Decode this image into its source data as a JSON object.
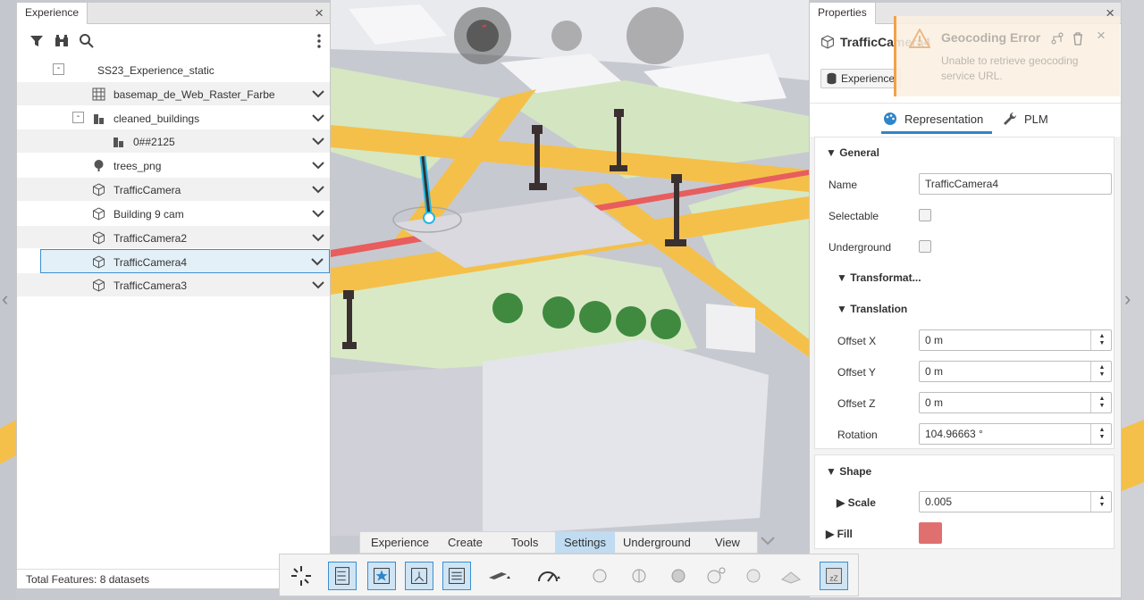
{
  "left_panel": {
    "tab": "Experience",
    "tree": [
      {
        "label": "SS23_Experience_static",
        "icon": "collapse-icon"
      },
      {
        "label": "basemap_de_Web_Raster_Farbe",
        "icon": "raster-icon"
      },
      {
        "label": "cleaned_buildings",
        "icon": "buildings-icon"
      },
      {
        "label": "0##2125",
        "icon": "buildings-icon"
      },
      {
        "label": "trees_png",
        "icon": "tree-icon"
      },
      {
        "label": "TrafficCamera",
        "icon": "cube-icon"
      },
      {
        "label": "Building 9 cam",
        "icon": "cube-icon"
      },
      {
        "label": "TrafficCamera2",
        "icon": "cube-icon"
      },
      {
        "label": "TrafficCamera4",
        "icon": "cube-icon"
      },
      {
        "label": "TrafficCamera3",
        "icon": "cube-icon"
      }
    ],
    "footer": "Total Features: 8 datasets"
  },
  "right_panel": {
    "tab": "Properties",
    "object_title": "TrafficCamera4",
    "experience_badge": "Experience",
    "tabs": {
      "representation": "Representation",
      "plm": "PLM"
    },
    "general": {
      "header": "General",
      "name_label": "Name",
      "name_value": "TrafficCamera4",
      "selectable_label": "Selectable",
      "underground_label": "Underground",
      "transform_header": "Transformat...",
      "translation_header": "Translation",
      "offset_x_label": "Offset X",
      "offset_x": "0 m",
      "offset_y_label": "Offset Y",
      "offset_y": "0 m",
      "offset_z_label": "Offset Z",
      "offset_z": "0 m",
      "rotation_label": "Rotation",
      "rotation": "104.96663 °"
    },
    "shape": {
      "header": "Shape",
      "scale_label": "Scale",
      "scale": "0.005",
      "fill_label": "Fill",
      "fill_color": "#e0706f"
    }
  },
  "toast": {
    "title": "Geocoding Error",
    "message": "Unable to retrieve geocoding service URL."
  },
  "menu": {
    "items": [
      "Experience",
      "Create",
      "Tools",
      "Settings",
      "Underground",
      "View"
    ],
    "active": "Settings"
  },
  "colors": {
    "accent": "#2f85c8",
    "selection": "#e4f0f8",
    "road": "#f4c04a",
    "grass": "#d7e8c4"
  }
}
